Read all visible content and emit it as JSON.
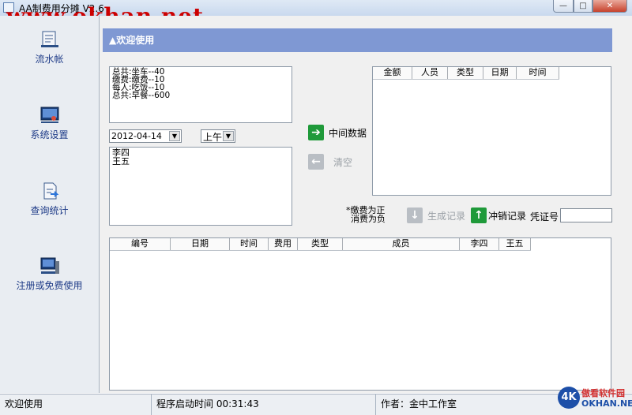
{
  "window": {
    "title": "AA制费用分摊 V2.6",
    "watermark": "www.okhan.net",
    "min_glyph": "—",
    "max_glyph": "□",
    "close_glyph": "✕"
  },
  "sidebar": {
    "items": [
      {
        "label": "流水帐",
        "icon": "ledger-icon"
      },
      {
        "label": "系统设置",
        "icon": "settings-monitor-icon"
      },
      {
        "label": "查询统计",
        "icon": "report-export-icon"
      },
      {
        "label": "注册或免费使用",
        "icon": "register-computer-icon"
      }
    ]
  },
  "banner": {
    "title": "▲欢迎使用"
  },
  "summary": {
    "lines": [
      "总共:坐车--40",
      "缴费:缴费--10",
      "每人:吃饭--10",
      "总共:早餐--600"
    ]
  },
  "date_picker": {
    "value": "2012-04-14",
    "arrow": "▼"
  },
  "period_select": {
    "value": "上午",
    "arrow": "▼"
  },
  "members": {
    "lines": [
      "李四",
      "王五"
    ]
  },
  "actions": {
    "middle_data": "中间数据",
    "clear": "清空",
    "generate": "生成记录",
    "reverse": "冲销记录",
    "arrow_right": "➔",
    "arrow_left": "←",
    "arrow_down": "↓",
    "arrow_up": "↑"
  },
  "note": {
    "line1": "*缴费为正",
    "line2": "消费为负"
  },
  "voucher": {
    "label": "凭证号",
    "value": ""
  },
  "mid_grid": {
    "columns": [
      "金额",
      "人员",
      "类型",
      "日期",
      "时间"
    ]
  },
  "record_grid": {
    "columns": [
      "编号",
      "日期",
      "时间",
      "费用",
      "类型",
      "成员",
      "李四",
      "王五"
    ]
  },
  "statusbar": {
    "welcome": "欢迎使用",
    "uptime": "程序启动时间 00:31:43",
    "author": "作者：金中工作室"
  },
  "logo": {
    "mark": "4K",
    "line1": "傲看软件园",
    "line2": "OKHAN.NET"
  },
  "colors": {
    "banner": "#7f98d3",
    "accent_green": "#1f9a3a",
    "nav_text": "#1f3c88"
  }
}
